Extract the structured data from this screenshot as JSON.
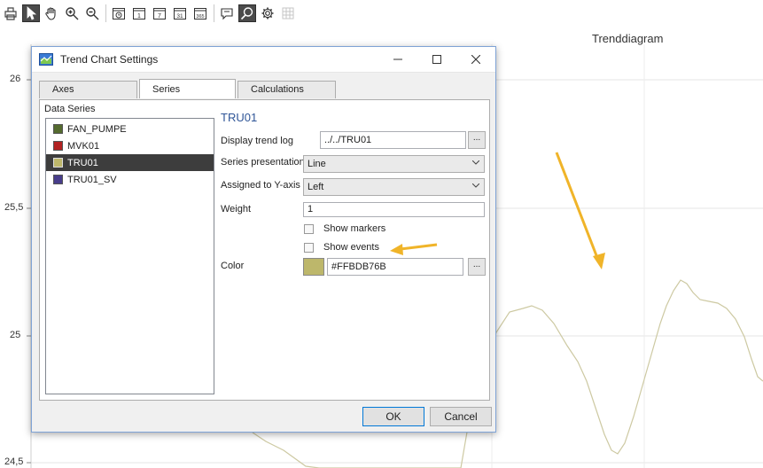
{
  "toolbar": {
    "icons": [
      "print-icon",
      "pointer-icon",
      "pan-hand-icon",
      "zoom-in-icon",
      "zoom-out-icon",
      "clock-icon",
      "calendar-1-day-icon",
      "calendar-7-day-icon",
      "calendar-31-day-icon",
      "calendar-365-day-icon",
      "comment-icon",
      "zoom-search-icon",
      "settings-gear-icon",
      "grid-icon"
    ],
    "cal_1": "1",
    "cal_7": "7",
    "cal_31": "31",
    "cal_365": "365"
  },
  "chart": {
    "title": "Trenddiagram",
    "y_ticks": [
      "26",
      "25,5",
      "25",
      "24,5"
    ],
    "line_color": "#c8c49a"
  },
  "dialog": {
    "title": "Trend Chart Settings",
    "tabs": [
      "Axes",
      "Series",
      "Calculations"
    ],
    "data_series_label": "Data Series",
    "series": [
      {
        "name": "FAN_PUMPE",
        "color": "#556b2f"
      },
      {
        "name": "MVK01",
        "color": "#b22222"
      },
      {
        "name": "TRU01",
        "color": "#bdb76b"
      },
      {
        "name": "TRU01_SV",
        "color": "#483d8b"
      }
    ],
    "selected_series": "TRU01",
    "fields": {
      "display_trend_log_label": "Display trend log",
      "display_trend_log_value": "../../TRU01",
      "series_presentation_label": "Series presentation",
      "series_presentation_value": "Line",
      "assigned_y_axis_label": "Assigned to Y-axis",
      "assigned_y_axis_value": "Left",
      "weight_label": "Weight",
      "weight_value": "1",
      "show_markers_label": "Show markers",
      "show_events_label": "Show events",
      "color_label": "Color",
      "color_value": "#FFBDB76B",
      "browse_label": "..."
    },
    "ok_label": "OK",
    "cancel_label": "Cancel"
  },
  "annotation_arrow_color": "#f0b429"
}
